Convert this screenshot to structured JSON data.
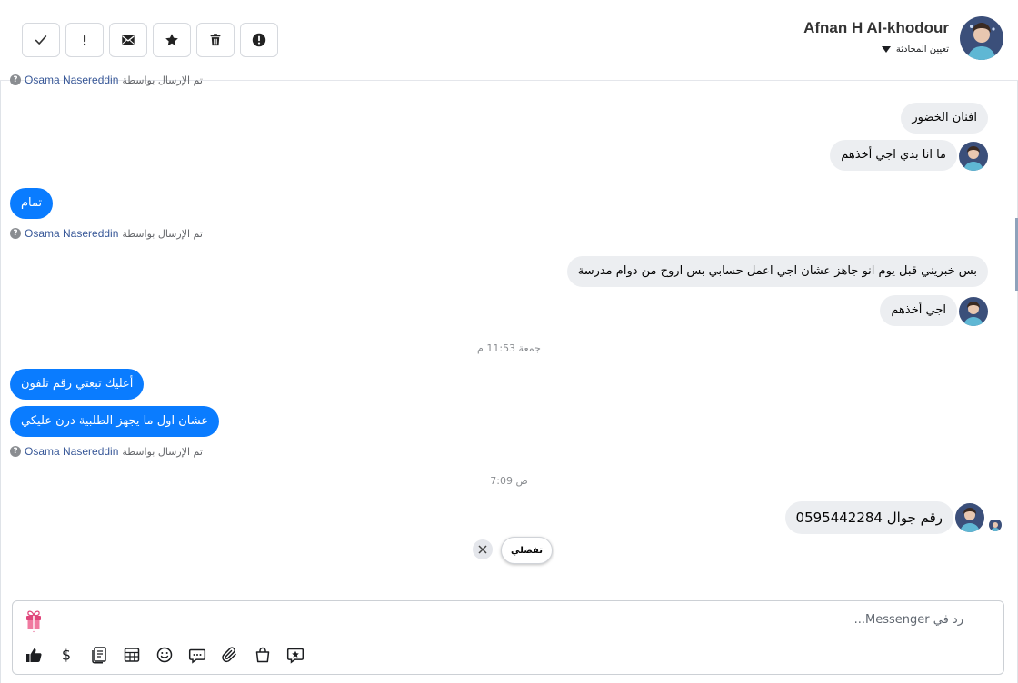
{
  "header": {
    "contact_name": "Afnan H Al-khodour",
    "assign_label": "تعيين المحادثة",
    "toolbar": [
      {
        "name": "mark-done-button",
        "icon": "check-icon"
      },
      {
        "name": "mark-important-button",
        "icon": "exclamation-icon"
      },
      {
        "name": "mark-unread-button",
        "icon": "envelope-icon"
      },
      {
        "name": "star-button",
        "icon": "star-icon"
      },
      {
        "name": "delete-button",
        "icon": "trash-icon"
      },
      {
        "name": "report-spam-button",
        "icon": "alert-circle-icon"
      }
    ]
  },
  "thread": {
    "clipped_sent_by": {
      "prefix": "تم الإرسال بواسطة",
      "sender": "Osama Nasereddin"
    },
    "messages": [
      {
        "dir": "in",
        "text": "افنان الخضور"
      },
      {
        "dir": "in",
        "text": "ما انا بدي اجي أخذهم"
      },
      {
        "dir": "out",
        "text": "تمام"
      },
      {
        "dir": "in",
        "text": "بس خبريني قبل يوم انو جاهز عشان اجي اعمل حسابي بس اروح من دوام مدرسة"
      },
      {
        "dir": "in",
        "text": "اجي أخذهم"
      },
      {
        "dir": "out",
        "text": "أعليك تبعتي رقم تلفون"
      },
      {
        "dir": "out",
        "text": "عشان اول ما يجهز الطلبية درن عليكي"
      },
      {
        "dir": "in",
        "text": "رقم جوال 0595442284"
      }
    ],
    "sent_by_1": {
      "prefix": "تم الإرسال بواسطة",
      "sender": "Osama Nasereddin"
    },
    "sent_by_2": {
      "prefix": "تم الإرسال بواسطة",
      "sender": "Osama Nasereddin"
    },
    "timestamp_1": "جمعة 11:53 م",
    "timestamp_2": "7:09 ص",
    "quick_reply": "تفضلي"
  },
  "composer": {
    "placeholder": "رد في Messenger..."
  },
  "colors": {
    "outgoing_bubble": "#0a7cff",
    "incoming_bubble": "#eceef1",
    "sender_link": "#385898"
  }
}
